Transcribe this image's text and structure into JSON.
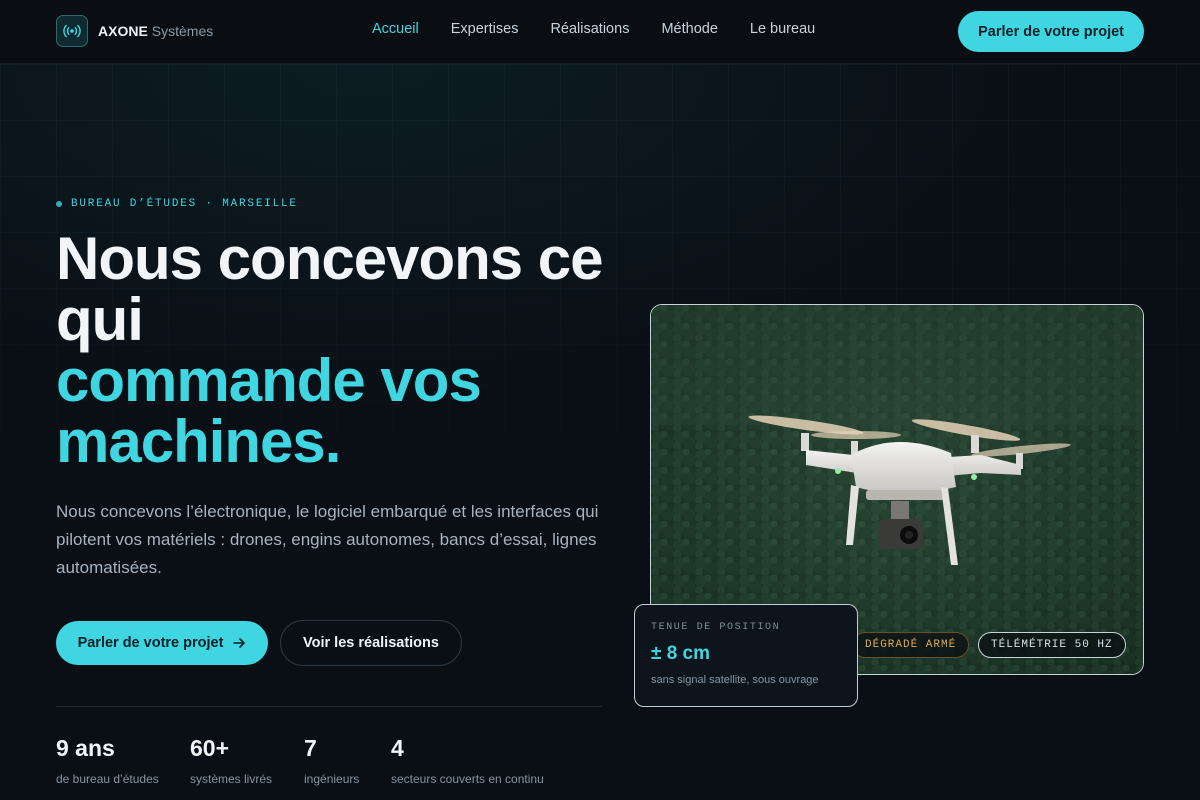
{
  "brand": {
    "name": "AXONE",
    "suffix": "Systèmes"
  },
  "nav": {
    "items": [
      {
        "label": "Accueil",
        "active": true
      },
      {
        "label": "Expertises",
        "active": false
      },
      {
        "label": "Réalisations",
        "active": false
      },
      {
        "label": "Méthode",
        "active": false
      },
      {
        "label": "Le bureau",
        "active": false
      }
    ],
    "cta": "Parler de votre projet"
  },
  "hero": {
    "eyebrow": "BUREAU D’ÉTUDES · MARSEILLE",
    "title_line1": "Nous concevons ce qui",
    "title_accent": "commande vos machines.",
    "lead": "Nous concevons l’électronique, le logiciel embarqué et les interfaces qui pilotent vos matériels : drones, engins autonomes, bancs d’essai, lignes automatisées.",
    "primary_cta": "Parler de votre projet",
    "secondary_cta": "Voir les réalisations"
  },
  "stats": [
    {
      "value": "9 ans",
      "label": "de bureau d’études"
    },
    {
      "value": "60+",
      "label": "systèmes livrés"
    },
    {
      "value": "7",
      "label": "ingénieurs"
    },
    {
      "value": "4",
      "label": "secteurs couverts en continu"
    }
  ],
  "media": {
    "tags": [
      {
        "label": "DÉGRADÉ ARMÉ",
        "kind": "warning"
      },
      {
        "label": "TÉLÉMÉTRIE 50 HZ",
        "kind": "neutral"
      }
    ],
    "overlay": {
      "label": "TENUE DE POSITION",
      "value": "± 8 cm",
      "note": "sans signal satellite, sous ouvrage"
    }
  },
  "colors": {
    "accent": "#3fd6e2",
    "background": "#0a0f15",
    "warning": "#e2a94a"
  }
}
